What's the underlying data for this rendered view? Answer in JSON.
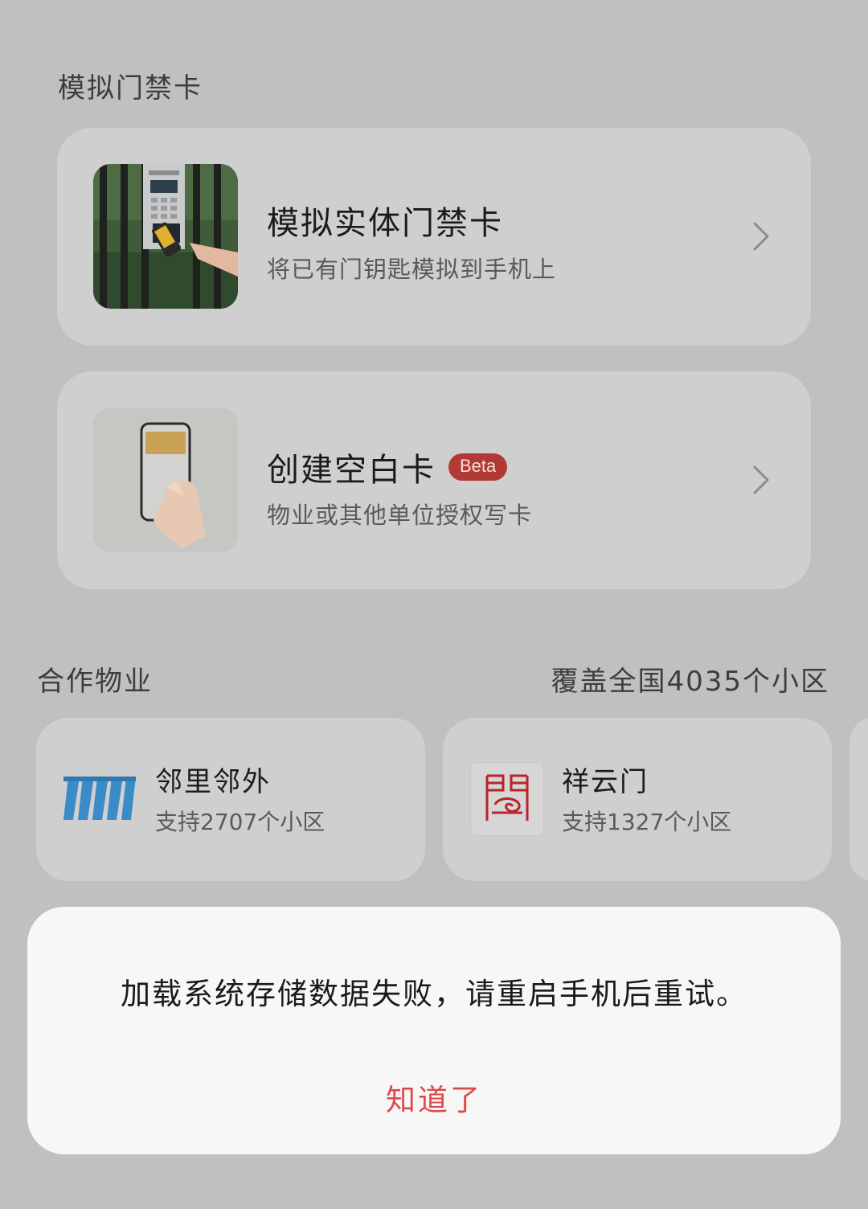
{
  "section": {
    "title": "模拟门禁卡"
  },
  "cards": [
    {
      "title": "模拟实体门禁卡",
      "subtitle": "将已有门钥匙模拟到手机上"
    },
    {
      "title": "创建空白卡",
      "badge": "Beta",
      "subtitle": "物业或其他单位授权写卡"
    }
  ],
  "partners": {
    "title": "合作物业",
    "coverage": "覆盖全国4035个小区",
    "items": [
      {
        "name": "邻里邻外",
        "desc": "支持2707个小区"
      },
      {
        "name": "祥云门",
        "desc": "支持1327个小区"
      }
    ]
  },
  "dialog": {
    "message": "加载系统存储数据失败，请重启手机后重试。",
    "confirm_label": "知道了"
  },
  "colors": {
    "background": "#c0c0c0",
    "card": "#cfcfcf",
    "badge": "#b23a35",
    "accent_red": "#e0494a"
  }
}
